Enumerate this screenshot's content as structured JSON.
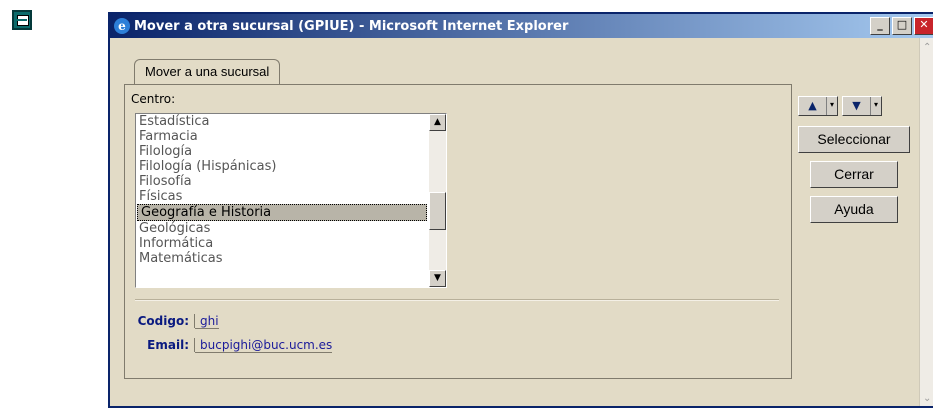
{
  "window": {
    "title": "Mover a otra sucursal (GPIUE) - Microsoft Internet Explorer",
    "icon": "ie-icon",
    "controls": {
      "minimize": "_",
      "maximize": "□",
      "close": "✕"
    }
  },
  "tab": {
    "label": "Mover a una sucursal"
  },
  "centro": {
    "label": "Centro:",
    "options": [
      "Estadística",
      "Farmacia",
      "Filología",
      "Filología (Hispánicas)",
      "Filosofía",
      "Físicas",
      "Geografía e Historia",
      "Geológicas",
      "Informática",
      "Matemáticas"
    ],
    "selected": "Geografía e Historia"
  },
  "info": {
    "codigo_label": "Codigo:",
    "codigo_value": "ghi",
    "email_label": "Email:",
    "email_value": "bucpighi@buc.ucm.es"
  },
  "actions": {
    "move_up": "▲",
    "move_down": "▼",
    "seleccionar": "Seleccionar",
    "cerrar": "Cerrar",
    "ayuda": "Ayuda"
  },
  "colors": {
    "title_bar": "#0a246a",
    "panel_bg": "#e2dbc6",
    "selection_bg": "#b8b4a8"
  }
}
